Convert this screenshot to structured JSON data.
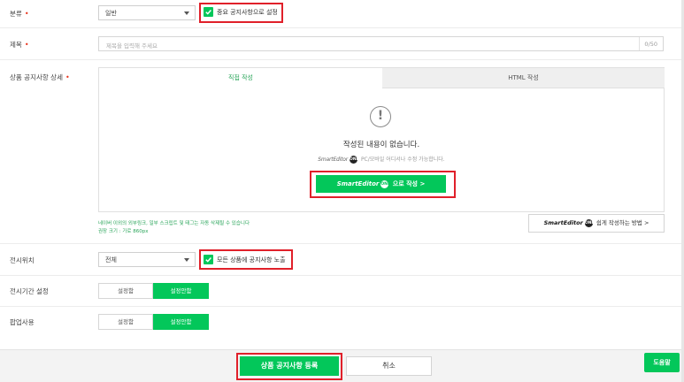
{
  "category": {
    "label": "분류",
    "required_mark": "•",
    "selected": "일반",
    "important_checkbox": {
      "label": "중요 공지사항으로 설정",
      "checked": true
    }
  },
  "title": {
    "label": "제목",
    "required_mark": "•",
    "placeholder": "제목을 입력해 주세요",
    "counter": "0/50"
  },
  "detail": {
    "label": "상품 공지사항 상세",
    "required_mark": "•",
    "tabs": {
      "direct": "직접 작성",
      "html": "HTML 작성"
    },
    "empty_icon": "!",
    "empty_title": "작성된 내용이 없습니다.",
    "logo_smarteditor": "SmartEditor",
    "logo_one": "ONE",
    "empty_sub": "PC/모바일 어디서나 수정 가능합니다.",
    "write_button_suffix": "으로 작성",
    "write_button_arrow": ">",
    "note_line1": "네이버 이외의 외부링크, 일부 스크립트 및 태그는 자동 삭제될 수 있습니다",
    "note_line2": "권장 크기 : 가로 860px",
    "help_link_text": "쉽게 작성하는 방법",
    "help_link_arrow": ">"
  },
  "display_location": {
    "label": "전시위치",
    "selected": "전체",
    "all_products_checkbox": {
      "label": "모든 상품에 공지사항 노출",
      "checked": true
    }
  },
  "display_period": {
    "label": "전시기간 설정",
    "options": {
      "set": "설정함",
      "unset": "설정안함"
    },
    "selected": "설정안함"
  },
  "popup": {
    "label": "팝업사용",
    "options": {
      "set": "설정함",
      "unset": "설정안함"
    },
    "selected": "설정안함"
  },
  "footer": {
    "submit": "상품 공지사항 등록",
    "cancel": "취소",
    "help": "도움말"
  },
  "colors": {
    "accent_green": "#03c75a",
    "highlight_red": "#e0202a",
    "required_red": "#e8341c"
  }
}
